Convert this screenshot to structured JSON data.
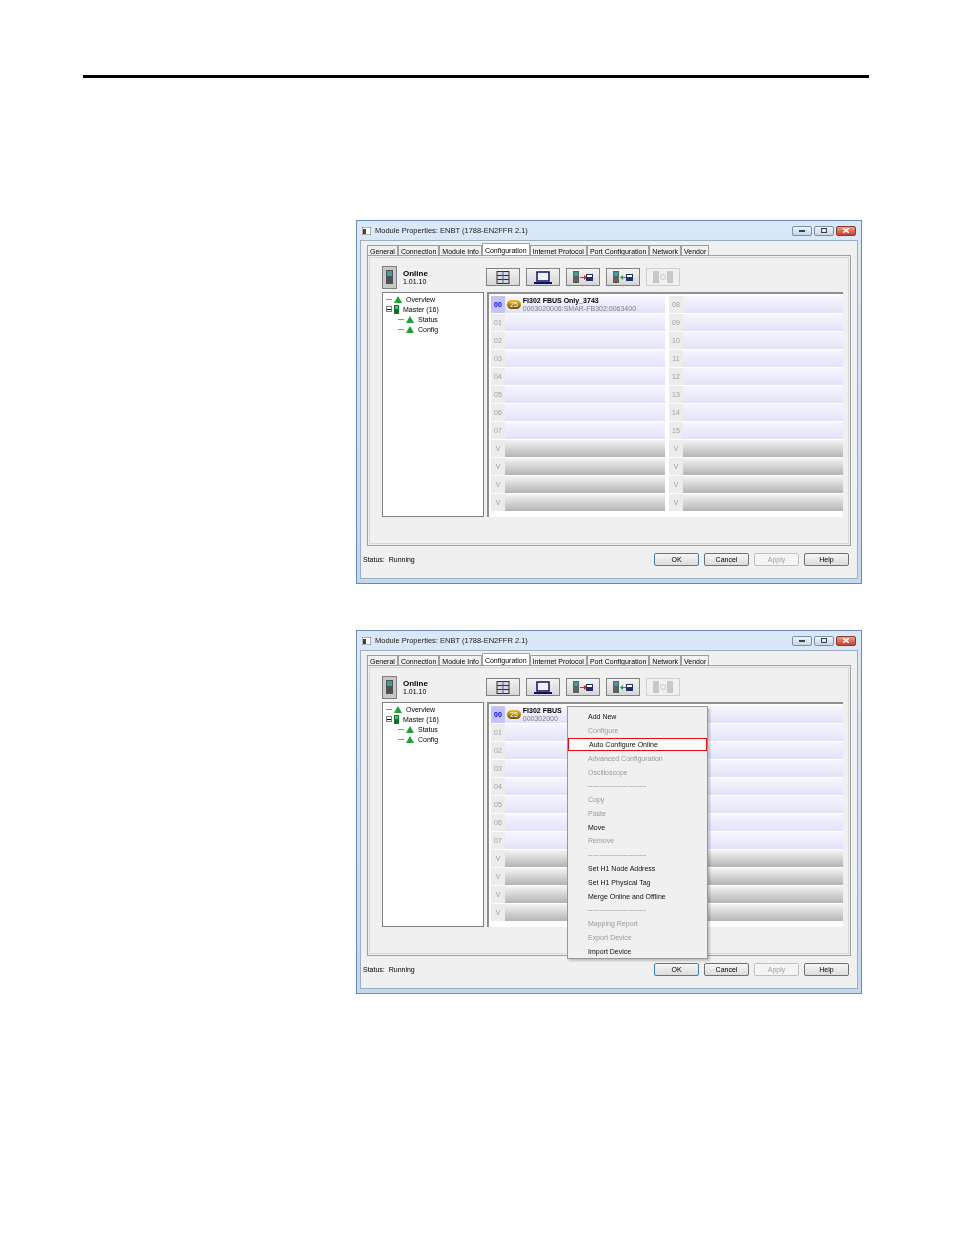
{
  "windows": [
    {
      "title": "Module Properties: ENBT (1788-EN2FFR 2.1)",
      "tabs": [
        {
          "label": "General",
          "selected": false
        },
        {
          "label": "Connection",
          "selected": false
        },
        {
          "label": "Module Info",
          "selected": false
        },
        {
          "label": "Configuration",
          "selected": true
        },
        {
          "label": "Internet Protocol",
          "selected": false
        },
        {
          "label": "Port Configuration",
          "selected": false
        },
        {
          "label": "Network",
          "selected": false
        },
        {
          "label": "Vendor",
          "selected": false
        }
      ],
      "mode": "Online",
      "version": "1.01.10",
      "toolbar": [
        {
          "kind": "rack",
          "disabled": false
        },
        {
          "kind": "laptop",
          "disabled": false
        },
        {
          "kind": "upload",
          "disabled": false
        },
        {
          "kind": "download",
          "disabled": false
        },
        {
          "kind": "sync",
          "disabled": true
        }
      ],
      "tree": [
        {
          "label": "Overview"
        },
        {
          "label": "Master (16)",
          "expanded": true,
          "children": [
            {
              "label": "Status"
            },
            {
              "label": "Config"
            }
          ]
        }
      ],
      "columns": [
        [
          {
            "kind": "node",
            "label": "00",
            "selected": true,
            "device": {
              "badge": "25",
              "name": "FI302 FBUS Only_3743",
              "id": "0003020006:SMAR-FB302:0063400"
            }
          },
          {
            "kind": "node",
            "label": "01",
            "selected": false
          },
          {
            "kind": "node",
            "label": "02",
            "selected": false
          },
          {
            "kind": "node",
            "label": "03",
            "selected": false
          },
          {
            "kind": "node",
            "label": "04",
            "selected": false
          },
          {
            "kind": "node",
            "label": "05",
            "selected": false
          },
          {
            "kind": "node",
            "label": "06",
            "selected": false
          },
          {
            "kind": "node",
            "label": "07",
            "selected": false
          },
          {
            "kind": "unused",
            "label": "V",
            "selected": false
          },
          {
            "kind": "unused",
            "label": "V",
            "selected": false
          },
          {
            "kind": "unused",
            "label": "V",
            "selected": false
          },
          {
            "kind": "unused",
            "label": "V",
            "selected": false
          }
        ],
        [
          {
            "kind": "node",
            "label": "08",
            "selected": false
          },
          {
            "kind": "node",
            "label": "09",
            "selected": false
          },
          {
            "kind": "node",
            "label": "10",
            "selected": false
          },
          {
            "kind": "node",
            "label": "11",
            "selected": false
          },
          {
            "kind": "node",
            "label": "12",
            "selected": false
          },
          {
            "kind": "node",
            "label": "13",
            "selected": false
          },
          {
            "kind": "node",
            "label": "14",
            "selected": false
          },
          {
            "kind": "node",
            "label": "15",
            "selected": false
          },
          {
            "kind": "unused",
            "label": "V",
            "selected": false
          },
          {
            "kind": "unused",
            "label": "V",
            "selected": false
          },
          {
            "kind": "unused",
            "label": "V",
            "selected": false
          },
          {
            "kind": "unused",
            "label": "V",
            "selected": false
          }
        ]
      ],
      "status": "Status:  Running",
      "buttons": [
        {
          "label": "OK",
          "disabled": false
        },
        {
          "label": "Cancel",
          "disabled": false
        },
        {
          "label": "Apply",
          "disabled": true
        },
        {
          "label": "Help",
          "disabled": false
        }
      ]
    },
    {
      "title": "Module Properties: ENBT (1788-EN2FFR 2.1)",
      "tabs": [
        {
          "label": "General",
          "selected": false
        },
        {
          "label": "Connection",
          "selected": false
        },
        {
          "label": "Module Info",
          "selected": false
        },
        {
          "label": "Configuration",
          "selected": true
        },
        {
          "label": "Internet Protocol",
          "selected": false
        },
        {
          "label": "Port Configuration",
          "selected": false
        },
        {
          "label": "Network",
          "selected": false
        },
        {
          "label": "Vendor",
          "selected": false
        }
      ],
      "mode": "Online",
      "version": "1.01.10",
      "toolbar": [
        {
          "kind": "rack",
          "disabled": false
        },
        {
          "kind": "laptop",
          "disabled": false
        },
        {
          "kind": "upload",
          "disabled": false
        },
        {
          "kind": "download",
          "disabled": false
        },
        {
          "kind": "sync",
          "disabled": true
        }
      ],
      "tree": [
        {
          "label": "Overview"
        },
        {
          "label": "Master (16)",
          "expanded": true,
          "children": [
            {
              "label": "Status"
            },
            {
              "label": "Config"
            }
          ]
        }
      ],
      "columns": [
        [
          {
            "kind": "node",
            "label": "00",
            "selected": true,
            "device": {
              "badge": "25",
              "name": "FI302 FBUS",
              "id": "000302000"
            }
          },
          {
            "kind": "node",
            "label": "01",
            "selected": false
          },
          {
            "kind": "node",
            "label": "02",
            "selected": false
          },
          {
            "kind": "node",
            "label": "03",
            "selected": false
          },
          {
            "kind": "node",
            "label": "04",
            "selected": false
          },
          {
            "kind": "node",
            "label": "05",
            "selected": false
          },
          {
            "kind": "node",
            "label": "06",
            "selected": false
          },
          {
            "kind": "node",
            "label": "07",
            "selected": false
          },
          {
            "kind": "unused",
            "label": "V",
            "selected": false
          },
          {
            "kind": "unused",
            "label": "V",
            "selected": false
          },
          {
            "kind": "unused",
            "label": "V",
            "selected": false
          },
          {
            "kind": "unused",
            "label": "V",
            "selected": false
          }
        ],
        [
          {
            "kind": "node"
          },
          {
            "kind": "node"
          },
          {
            "kind": "node"
          },
          {
            "kind": "node"
          },
          {
            "kind": "node"
          },
          {
            "kind": "node"
          },
          {
            "kind": "node"
          },
          {
            "kind": "node"
          },
          {
            "kind": "unused"
          },
          {
            "kind": "unused"
          },
          {
            "kind": "unused"
          },
          {
            "kind": "unused"
          }
        ]
      ],
      "status": "Status:  Running",
      "buttons": [
        {
          "label": "OK",
          "disabled": false
        },
        {
          "label": "Cancel",
          "disabled": false
        },
        {
          "label": "Apply",
          "disabled": true
        },
        {
          "label": "Help",
          "disabled": false
        }
      ],
      "context_menu": [
        {
          "kind": "item",
          "label": "Add New",
          "disabled": false,
          "selected": false
        },
        {
          "kind": "item",
          "label": "Configure",
          "disabled": true,
          "selected": false
        },
        {
          "kind": "item",
          "label": "Auto Configure Online",
          "disabled": false,
          "selected": true
        },
        {
          "kind": "item",
          "label": "Advanced Configuration",
          "disabled": true,
          "selected": false
        },
        {
          "kind": "item",
          "label": "Oscilloscope",
          "disabled": true,
          "selected": false
        },
        {
          "kind": "separator",
          "label": "-------------------------"
        },
        {
          "kind": "item",
          "label": "Copy",
          "disabled": true,
          "selected": false
        },
        {
          "kind": "item",
          "label": "Paste",
          "disabled": true,
          "selected": false
        },
        {
          "kind": "item",
          "label": "Move",
          "disabled": false,
          "selected": false
        },
        {
          "kind": "item",
          "label": "Remove",
          "disabled": true,
          "selected": false
        },
        {
          "kind": "separator",
          "label": "-------------------------"
        },
        {
          "kind": "item",
          "label": "Set H1 Node Address",
          "disabled": false,
          "selected": false
        },
        {
          "kind": "item",
          "label": "Set H1 Physical Tag",
          "disabled": false,
          "selected": false
        },
        {
          "kind": "item",
          "label": "Merge Online and Offline",
          "disabled": false,
          "selected": false
        },
        {
          "kind": "separator",
          "label": "-------------------------"
        },
        {
          "kind": "item",
          "label": "Mapping Report",
          "disabled": true,
          "selected": false
        },
        {
          "kind": "item",
          "label": "Export Device",
          "disabled": true,
          "selected": false
        },
        {
          "kind": "item",
          "label": "Import Device",
          "disabled": false,
          "selected": false
        }
      ]
    }
  ]
}
